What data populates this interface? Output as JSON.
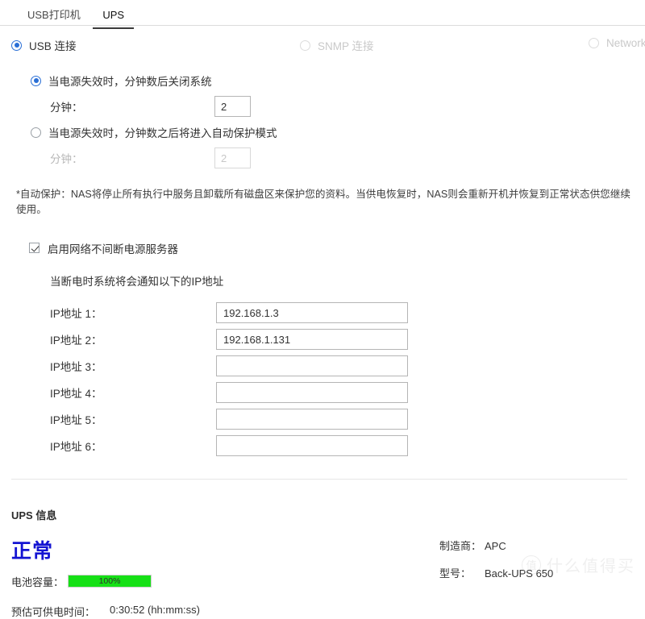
{
  "tabs": [
    {
      "label": "USB打印机",
      "active": false
    },
    {
      "label": "UPS",
      "active": true
    }
  ],
  "connection": {
    "usb": {
      "label": "USB 连接",
      "selected": true,
      "disabled": false
    },
    "snmp": {
      "label": "SNMP 连接",
      "selected": false,
      "disabled": true
    },
    "network": {
      "label": "Network",
      "selected": false,
      "disabled": true
    }
  },
  "shutdown": {
    "option1": {
      "label": "当电源失效时，分钟数后关闭系统",
      "selected": true,
      "minutes_label": "分钟：",
      "minutes_value": "2",
      "disabled": false
    },
    "option2": {
      "label": "当电源失效时，分钟数之后将进入自动保护模式",
      "selected": false,
      "minutes_label": "分钟：",
      "minutes_value": "2",
      "disabled": true
    },
    "note": "*自动保护：NAS将停止所有执行中服务且卸载所有磁盘区来保护您的资料。当供电恢复时，NAS则会重新开机并恢复到正常状态供您继续使用。"
  },
  "network_ups": {
    "enable_label": "启用网络不间断电源服务器",
    "enabled": true,
    "notify_text": "当断电时系统将会通知以下的IP地址",
    "ip_fields": [
      {
        "label": "IP地址 1：",
        "value": "192.168.1.3"
      },
      {
        "label": "IP地址 2：",
        "value": "192.168.1.131"
      },
      {
        "label": "IP地址 3：",
        "value": ""
      },
      {
        "label": "IP地址 4：",
        "value": ""
      },
      {
        "label": "IP地址 5：",
        "value": ""
      },
      {
        "label": "IP地址 6：",
        "value": ""
      }
    ]
  },
  "ups_info": {
    "title": "UPS 信息",
    "status": "正常",
    "status_color": "#1414d2",
    "battery_label": "电池容量：",
    "battery_percent_text": "100%",
    "battery_percent": 100,
    "battery_color": "#16e016",
    "runtime_label": "预估可供电时间：",
    "runtime_value": "0:30:52 (hh:mm:ss)",
    "manufacturer_label": "制造商：",
    "manufacturer_value": "APC",
    "model_label": "型号：",
    "model_value": "Back-UPS 650"
  },
  "watermark": {
    "badge": "值",
    "text": "什么值得买"
  }
}
